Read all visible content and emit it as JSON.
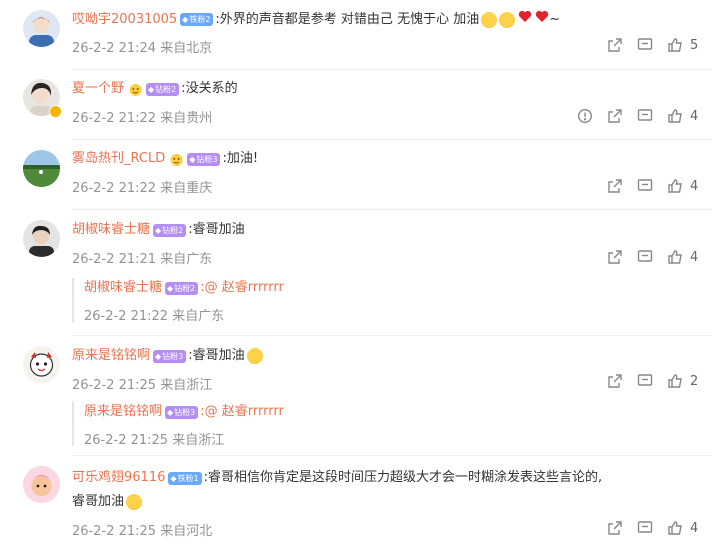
{
  "comments": [
    {
      "username": "哎呦宇20031005",
      "fan_badge": "铁粉2",
      "text": ":外界的声音都是参考 对错由己 无愧于心 加油",
      "suffix": "~",
      "time": "26-2-2 21:24",
      "location": "来自北京",
      "likes": "5"
    },
    {
      "username": "夏一个野",
      "fan_badge": "钻粉2",
      "text": ":没关系的",
      "time": "26-2-2 21:22",
      "location": "来自贵州",
      "likes": "4"
    },
    {
      "username": "雾岛热刊_RCLD",
      "fan_badge": "钻粉3",
      "text": ":加油!",
      "time": "26-2-2 21:22",
      "location": "来自重庆",
      "likes": "4"
    },
    {
      "username": "胡椒味睿士糖",
      "fan_badge": "钻粉2",
      "text": ":睿哥加油",
      "time": "26-2-2 21:21",
      "location": "来自广东",
      "likes": "4",
      "reply": {
        "username": "胡椒味睿士糖",
        "fan_badge": "钻粉2",
        "mention": ":@ 赵睿rrrrrrr",
        "time": "26-2-2 21:22",
        "location": "来自广东"
      }
    },
    {
      "username": "原来是铭铭啊",
      "fan_badge": "钻粉3",
      "text": ":睿哥加油",
      "time": "26-2-2 21:25",
      "location": "来自浙江",
      "likes": "2",
      "reply": {
        "username": "原来是铭铭啊",
        "fan_badge": "钻粉3",
        "mention": ":@ 赵睿rrrrrrr",
        "time": "26-2-2 21:25",
        "location": "来自浙江"
      }
    },
    {
      "username": "可乐鸡翅96116",
      "fan_badge": "铁粉1",
      "text": ":睿哥相信你肯定是这段时间压力超级大才会一时糊涂发表这些言论的,",
      "text2": "睿哥加油",
      "time": "26-2-2 21:25",
      "location": "来自河北",
      "likes": "4"
    }
  ],
  "icons": {
    "share": "share-icon",
    "comment": "comment-icon",
    "like": "thumbs-up-icon",
    "report": "report-icon"
  },
  "colors": {
    "username": "#eb7350",
    "meta": "#939393",
    "iron_badge": "#6aa9f5",
    "diamond_badge": "#b48ef5"
  }
}
